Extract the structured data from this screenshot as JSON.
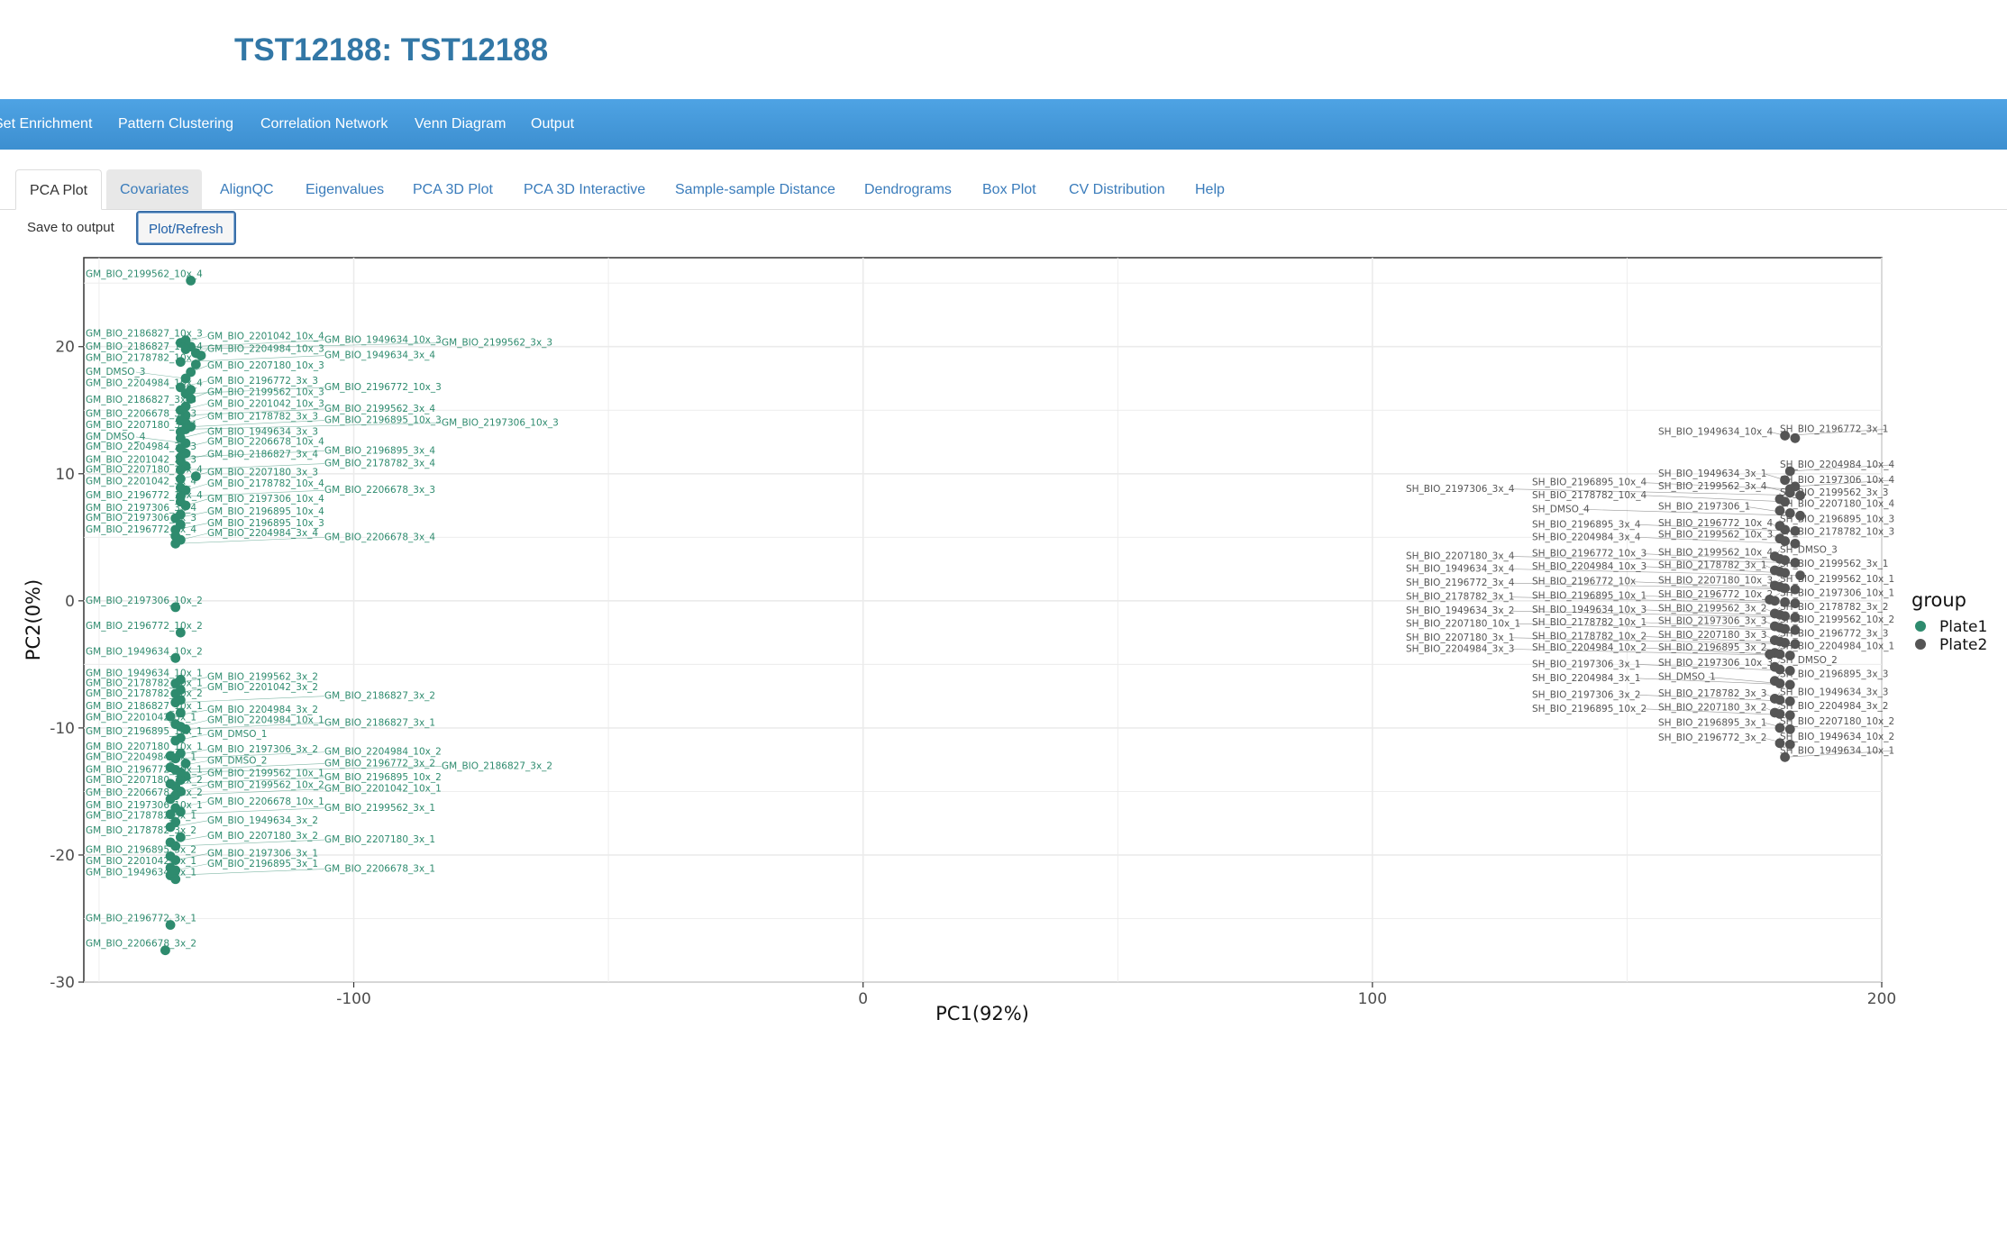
{
  "app": {
    "title": "TST12188: TST12188"
  },
  "navbar": {
    "items": [
      "Set Enrichment",
      "Pattern Clustering",
      "Correlation Network",
      "Venn Diagram",
      "Output"
    ]
  },
  "tabs": [
    "PCA Plot",
    "Covariates",
    "AlignQC",
    "Eigenvalues",
    "PCA 3D Plot",
    "PCA 3D Interactive",
    "Sample-sample Distance",
    "Dendrograms",
    "Box Plot",
    "CV Distribution",
    "Help"
  ],
  "buttons": {
    "save": "Save to output",
    "plot": "Plot/Refresh"
  },
  "chart_data": {
    "type": "scatter",
    "title": "",
    "xlabel": "PC1(92%)",
    "ylabel": "PC2(0%)",
    "xlim": [
      -153,
      200
    ],
    "ylim": [
      -30,
      27
    ],
    "xticks": [
      -100,
      0,
      100,
      200
    ],
    "yticks": [
      20,
      10,
      0,
      -10,
      -20,
      -30
    ],
    "grid": true,
    "legend": {
      "title": "group",
      "position": "right",
      "entries": [
        "Plate1",
        "Plate2"
      ]
    },
    "colors": {
      "Plate1": "#2e8b6e",
      "Plate2": "#555555"
    },
    "series": [
      {
        "name": "Plate1",
        "points": [
          {
            "label": "GM_BIO_2199562_10x_4",
            "x": -132,
            "y": 25.2
          },
          {
            "label": "GM_BIO_2186827_10x_3",
            "x": -133,
            "y": 20.5
          },
          {
            "label": "GM_BIO_2201042_10x_4",
            "x": -134,
            "y": 20.3
          },
          {
            "label": "GM_BIO_1949634_10x_3",
            "x": -132,
            "y": 20.0
          },
          {
            "label": "GM_BIO_2199562_3x_3",
            "x": -133,
            "y": 19.8
          },
          {
            "label": "GM_BIO_2186827_10x_4",
            "x": -131,
            "y": 19.5
          },
          {
            "label": "GM_BIO_2204984_10x_3",
            "x": -130,
            "y": 19.3
          },
          {
            "label": "GM_BIO_1949634_3x_4",
            "x": -134,
            "y": 18.8
          },
          {
            "label": "GM_BIO_2178782_10x_3",
            "x": -131,
            "y": 18.6
          },
          {
            "label": "GM_BIO_2207180_10x_3",
            "x": -132,
            "y": 18.0
          },
          {
            "label": "GM_DMSO_3",
            "x": -133,
            "y": 17.5
          },
          {
            "label": "GM_BIO_2196772_3x_3",
            "x": -134,
            "y": 16.8
          },
          {
            "label": "GM_BIO_2204984_10x_4",
            "x": -132,
            "y": 16.6
          },
          {
            "label": "GM_BIO_2196772_10x_3",
            "x": -133,
            "y": 16.3
          },
          {
            "label": "GM_BIO_2199562_10x_3",
            "x": -132,
            "y": 15.9
          },
          {
            "label": "GM_BIO_2186827_3x_3",
            "x": -133,
            "y": 15.3
          },
          {
            "label": "GM_BIO_2201042_10x_3",
            "x": -134,
            "y": 15.0
          },
          {
            "label": "GM_BIO_2199562_3x_4",
            "x": -133,
            "y": 14.6
          },
          {
            "label": "GM_BIO_2206678_3x_3",
            "x": -134,
            "y": 14.2
          },
          {
            "label": "GM_BIO_2178782_3x_3",
            "x": -133,
            "y": 14.0
          },
          {
            "label": "GM_BIO_2207180_3x_4",
            "x": -134,
            "y": 13.3
          },
          {
            "label": "GM_BIO_2197306_10x_3",
            "x": -133,
            "y": 13.5
          },
          {
            "label": "GM_BIO_2196895_10x_3",
            "x": -132,
            "y": 13.7
          },
          {
            "label": "GM_BIO_1949634_3x_3",
            "x": -134,
            "y": 12.8
          },
          {
            "label": "GM_DMSO_4",
            "x": -133,
            "y": 12.4
          },
          {
            "label": "GM_BIO_2206678_10x_4",
            "x": -134,
            "y": 12.0
          },
          {
            "label": "GM_BIO_2204984_3x_3",
            "x": -133,
            "y": 11.6
          },
          {
            "label": "GM_BIO_2196895_3x_4",
            "x": -134,
            "y": 11.3
          },
          {
            "label": "GM_BIO_2186827_3x_4",
            "x": -134,
            "y": 11.0
          },
          {
            "label": "GM_BIO_2201042_3x_3",
            "x": -133,
            "y": 10.6
          },
          {
            "label": "GM_BIO_2178782_3x_4",
            "x": -134,
            "y": 10.3
          },
          {
            "label": "GM_BIO_2207180_10x_4",
            "x": -131,
            "y": 9.8
          },
          {
            "label": "GM_BIO_2207180_3x_3",
            "x": -134,
            "y": 9.6
          },
          {
            "label": "GM_BIO_2201042_3x_4",
            "x": -134,
            "y": 8.9
          },
          {
            "label": "GM_BIO_2178782_10x_4",
            "x": -133,
            "y": 8.7
          },
          {
            "label": "GM_BIO_2206678_3x_3",
            "x": -134,
            "y": 8.2
          },
          {
            "label": "GM_BIO_2196772_10x_4",
            "x": -134,
            "y": 7.8
          },
          {
            "label": "GM_BIO_2197306_10x_4",
            "x": -133,
            "y": 7.5
          },
          {
            "label": "GM_BIO_2197306_3x_4",
            "x": -134,
            "y": 6.8
          },
          {
            "label": "GM_BIO_2196895_10x_4",
            "x": -135,
            "y": 6.5
          },
          {
            "label": "GM_BIO_2197306_3x_3",
            "x": -134,
            "y": 6.0
          },
          {
            "label": "GM_BIO_2196895_10x_3",
            "x": -135,
            "y": 5.6
          },
          {
            "label": "GM_BIO_2196772_3x_4",
            "x": -135,
            "y": 5.1
          },
          {
            "label": "GM_BIO_2204984_3x_4",
            "x": -134,
            "y": 4.8
          },
          {
            "label": "GM_BIO_2206678_3x_4",
            "x": -135,
            "y": 4.5
          },
          {
            "label": "GM_BIO_2197306_10x_2",
            "x": -135,
            "y": -0.5
          },
          {
            "label": "GM_BIO_2196772_10x_2",
            "x": -134,
            "y": -2.5
          },
          {
            "label": "GM_BIO_1949634_10x_2",
            "x": -135,
            "y": -4.5
          },
          {
            "label": "GM_BIO_1949634_10x_1",
            "x": -134,
            "y": -6.2
          },
          {
            "label": "GM_BIO_2199562_3x_2",
            "x": -135,
            "y": -6.5
          },
          {
            "label": "GM_BIO_2178782_10x_1",
            "x": -134,
            "y": -7.0
          },
          {
            "label": "GM_BIO_2201042_3x_2",
            "x": -135,
            "y": -7.3
          },
          {
            "label": "GM_BIO_2178782_10x_2",
            "x": -134,
            "y": -7.8
          },
          {
            "label": "GM_BIO_2186827_3x_2",
            "x": -135,
            "y": -8.0
          },
          {
            "label": "GM_BIO_2186827_10x_1",
            "x": -134,
            "y": -8.8
          },
          {
            "label": "GM_BIO_2204984_3x_2",
            "x": -136,
            "y": -9.1
          },
          {
            "label": "GM_BIO_2201042_3x_1",
            "x": -135,
            "y": -9.7
          },
          {
            "label": "GM_BIO_2204984_10x_1",
            "x": -134,
            "y": -9.9
          },
          {
            "label": "GM_BIO_2186827_3x_1",
            "x": -133,
            "y": -10.1
          },
          {
            "label": "GM_BIO_2196895_10x_1",
            "x": -134,
            "y": -10.8
          },
          {
            "label": "GM_DMSO_1",
            "x": -135,
            "y": -11.0
          },
          {
            "label": "GM_BIO_2207180_10x_1",
            "x": -134,
            "y": -12.0
          },
          {
            "label": "GM_BIO_2197306_3x_2",
            "x": -136,
            "y": -12.2
          },
          {
            "label": "GM_BIO_2204984_10x_2",
            "x": -135,
            "y": -12.4
          },
          {
            "label": "GM_BIO_2204984_3x_1",
            "x": -133,
            "y": -12.8
          },
          {
            "label": "GM_DMSO_2",
            "x": -136,
            "y": -13.1
          },
          {
            "label": "GM_BIO_2196772_3x_2",
            "x": -135,
            "y": -13.3
          },
          {
            "label": "GM_BIO_2186827_3x_2",
            "x": -134,
            "y": -13.5
          },
          {
            "label": "GM_BIO_2196772_10x_1",
            "x": -133,
            "y": -13.8
          },
          {
            "label": "GM_BIO_2199562_10x_1",
            "x": -134,
            "y": -14.1
          },
          {
            "label": "GM_BIO_2196895_10x_2",
            "x": -136,
            "y": -14.4
          },
          {
            "label": "GM_BIO_2207180_10x_2",
            "x": -135,
            "y": -14.6
          },
          {
            "label": "GM_BIO_2199562_10x_2",
            "x": -134,
            "y": -15.0
          },
          {
            "label": "GM_BIO_2201042_10x_1",
            "x": -135,
            "y": -15.3
          },
          {
            "label": "GM_BIO_2206678_10x_2",
            "x": -136,
            "y": -15.6
          },
          {
            "label": "GM_BIO_2206678_10x_1",
            "x": -135,
            "y": -16.3
          },
          {
            "label": "GM_BIO_2197306_10x_1",
            "x": -134,
            "y": -16.6
          },
          {
            "label": "GM_BIO_2199562_3x_1",
            "x": -136,
            "y": -16.8
          },
          {
            "label": "GM_BIO_2178782_3x_1",
            "x": -135,
            "y": -17.4
          },
          {
            "label": "GM_BIO_1949634_3x_2",
            "x": -136,
            "y": -17.8
          },
          {
            "label": "GM_BIO_2178782_3x_2",
            "x": -134,
            "y": -18.6
          },
          {
            "label": "GM_BIO_2207180_3x_2",
            "x": -136,
            "y": -19.0
          },
          {
            "label": "GM_BIO_2207180_3x_1",
            "x": -135,
            "y": -19.3
          },
          {
            "label": "GM_BIO_2196895_3x_2",
            "x": -136,
            "y": -20.1
          },
          {
            "label": "GM_BIO_2197306_3x_1",
            "x": -135,
            "y": -20.4
          },
          {
            "label": "GM_BIO_2201042_3x_1",
            "x": -136,
            "y": -21.0
          },
          {
            "label": "GM_BIO_2196895_3x_1",
            "x": -135,
            "y": -21.2
          },
          {
            "label": "GM_BIO_2206678_3x_1",
            "x": -136,
            "y": -21.6
          },
          {
            "label": "GM_BIO_1949634_3x_1",
            "x": -135,
            "y": -21.9
          },
          {
            "label": "GM_BIO_2196772_3x_1",
            "x": -136,
            "y": -25.5
          },
          {
            "label": "GM_BIO_2206678_3x_2",
            "x": -137,
            "y": -27.5
          }
        ]
      },
      {
        "name": "Plate2",
        "points": [
          {
            "label": "SH_BIO_2196772_3x_1",
            "x": 181,
            "y": 13.0
          },
          {
            "label": "SH_BIO_1949634_10x_4",
            "x": 183,
            "y": 12.8
          },
          {
            "label": "SH_BIO_2204984_10x_4",
            "x": 182,
            "y": 10.2
          },
          {
            "label": "SH_BIO_1949634_3x_1",
            "x": 181,
            "y": 9.5
          },
          {
            "label": "SH_BIO_2197306_10x_4",
            "x": 183,
            "y": 9.0
          },
          {
            "label": "SH_BIO_2196895_10x_4",
            "x": 182,
            "y": 8.8
          },
          {
            "label": "SH_BIO_2199562_3x_4",
            "x": 182,
            "y": 8.5
          },
          {
            "label": "SH_BIO_2197306_3x_4",
            "x": 184,
            "y": 8.3
          },
          {
            "label": "SH_BIO_2199562_3x_3",
            "x": 180,
            "y": 8.0
          },
          {
            "label": "SH_BIO_2178782_10x_4",
            "x": 181,
            "y": 7.8
          },
          {
            "label": "SH_BIO_2207180_10x_4",
            "x": 180,
            "y": 7.1
          },
          {
            "label": "SH_BIO_2197306_1",
            "x": 182,
            "y": 6.9
          },
          {
            "label": "SH_DMSO_4",
            "x": 184,
            "y": 6.7
          },
          {
            "label": "SH_BIO_2196895_10x_3",
            "x": 180,
            "y": 5.9
          },
          {
            "label": "SH_BIO_2196772_10x_4",
            "x": 181,
            "y": 5.6
          },
          {
            "label": "SH_BIO_2196895_3x_4",
            "x": 183,
            "y": 5.5
          },
          {
            "label": "SH_BIO_2178782_10x_3",
            "x": 180,
            "y": 4.9
          },
          {
            "label": "SH_BIO_2199562_10x_3",
            "x": 181,
            "y": 4.7
          },
          {
            "label": "SH_BIO_2204984_3x_4",
            "x": 183,
            "y": 4.5
          },
          {
            "label": "SH_DMSO_3",
            "x": 179,
            "y": 3.5
          },
          {
            "label": "SH_BIO_2199562_10x_4",
            "x": 180,
            "y": 3.3
          },
          {
            "label": "SH_BIO_2196772_10x_3",
            "x": 181,
            "y": 3.2
          },
          {
            "label": "SH_BIO_2207180_3x_4",
            "x": 183,
            "y": 3.0
          },
          {
            "label": "SH_BIO_2199562_3x_1",
            "x": 179,
            "y": 2.4
          },
          {
            "label": "SH_BIO_2178782_3x_1",
            "x": 180,
            "y": 2.3
          },
          {
            "label": "SH_BIO_2204984_10x_3",
            "x": 181,
            "y": 2.2
          },
          {
            "label": "SH_BIO_1949634_3x_4",
            "x": 184,
            "y": 2.0
          },
          {
            "label": "SH_BIO_2199562_10x_1",
            "x": 179,
            "y": 1.2
          },
          {
            "label": "SH_BIO_2207180_10x_3",
            "x": 180,
            "y": 1.1
          },
          {
            "label": "SH_BIO_2196772_10x",
            "x": 181,
            "y": 1.0
          },
          {
            "label": "SH_BIO_2196772_3x_4",
            "x": 183,
            "y": 0.9
          },
          {
            "label": "SH_BIO_2197306_10x_1",
            "x": 178,
            "y": 0.1
          },
          {
            "label": "SH_BIO_2196772_10x_2",
            "x": 179,
            "y": 0.0
          },
          {
            "label": "SH_BIO_2196895_10x_1",
            "x": 181,
            "y": -0.1
          },
          {
            "label": "SH_BIO_2178782_3x_1",
            "x": 183,
            "y": -0.2
          },
          {
            "label": "SH_BIO_2178782_3x_2",
            "x": 179,
            "y": -1.0
          },
          {
            "label": "SH_BIO_2199562_3x_2",
            "x": 180,
            "y": -1.1
          },
          {
            "label": "SH_BIO_1949634_10x_3",
            "x": 181,
            "y": -1.2
          },
          {
            "label": "SH_BIO_1949634_3x_2",
            "x": 183,
            "y": -1.3
          },
          {
            "label": "SH_BIO_2199562_10x_2",
            "x": 179,
            "y": -2.0
          },
          {
            "label": "SH_BIO_2197306_3x_3",
            "x": 180,
            "y": -2.1
          },
          {
            "label": "SH_BIO_2178782_10x_1",
            "x": 181,
            "y": -2.2
          },
          {
            "label": "SH_BIO_2207180_10x_1",
            "x": 183,
            "y": -2.3
          },
          {
            "label": "SH_BIO_2196772_3x_3",
            "x": 179,
            "y": -3.1
          },
          {
            "label": "SH_BIO_2207180_3x_3",
            "x": 180,
            "y": -3.2
          },
          {
            "label": "SH_BIO_2178782_10x_2",
            "x": 181,
            "y": -3.3
          },
          {
            "label": "SH_BIO_2207180_3x_1",
            "x": 183,
            "y": -3.4
          },
          {
            "label": "SH_BIO_2204984_10x_1",
            "x": 179,
            "y": -4.1
          },
          {
            "label": "SH_BIO_2196895_3x_2",
            "x": 180,
            "y": -4.2
          },
          {
            "label": "SH_BIO_2204984_3x_3",
            "x": 182,
            "y": -4.3
          },
          {
            "label": "SH_BIO_2204984_10x_2",
            "x": 178,
            "y": -4.2
          },
          {
            "label": "SH_DMSO_2",
            "x": 179,
            "y": -5.2
          },
          {
            "label": "SH_BIO_2197306_10x_3",
            "x": 180,
            "y": -5.4
          },
          {
            "label": "SH_BIO_2197306_3x_1",
            "x": 182,
            "y": -5.5
          },
          {
            "label": "SH_BIO_2196895_3x_3",
            "x": 179,
            "y": -6.3
          },
          {
            "label": "SH_DMSO_1",
            "x": 180,
            "y": -6.5
          },
          {
            "label": "SH_BIO_2204984_3x_1",
            "x": 182,
            "y": -6.6
          },
          {
            "label": "SH_BIO_1949634_3x_3",
            "x": 179,
            "y": -7.7
          },
          {
            "label": "SH_BIO_2178782_3x_3",
            "x": 180,
            "y": -7.8
          },
          {
            "label": "SH_BIO_2197306_3x_2",
            "x": 182,
            "y": -7.9
          },
          {
            "label": "SH_BIO_2204984_3x_2",
            "x": 179,
            "y": -8.8
          },
          {
            "label": "SH_BIO_2207180_3x_2",
            "x": 180,
            "y": -8.9
          },
          {
            "label": "SH_BIO_2196895_10x_2",
            "x": 182,
            "y": -9.0
          },
          {
            "label": "SH_BIO_2207180_10x_2",
            "x": 180,
            "y": -10.0
          },
          {
            "label": "SH_BIO_2196895_3x_1",
            "x": 182,
            "y": -10.1
          },
          {
            "label": "SH_BIO_1949634_10x_2",
            "x": 180,
            "y": -11.2
          },
          {
            "label": "SH_BIO_2196772_3x_2",
            "x": 182,
            "y": -11.3
          },
          {
            "label": "SH_BIO_1949634_10x_1",
            "x": 181,
            "y": -12.3
          }
        ]
      }
    ]
  }
}
